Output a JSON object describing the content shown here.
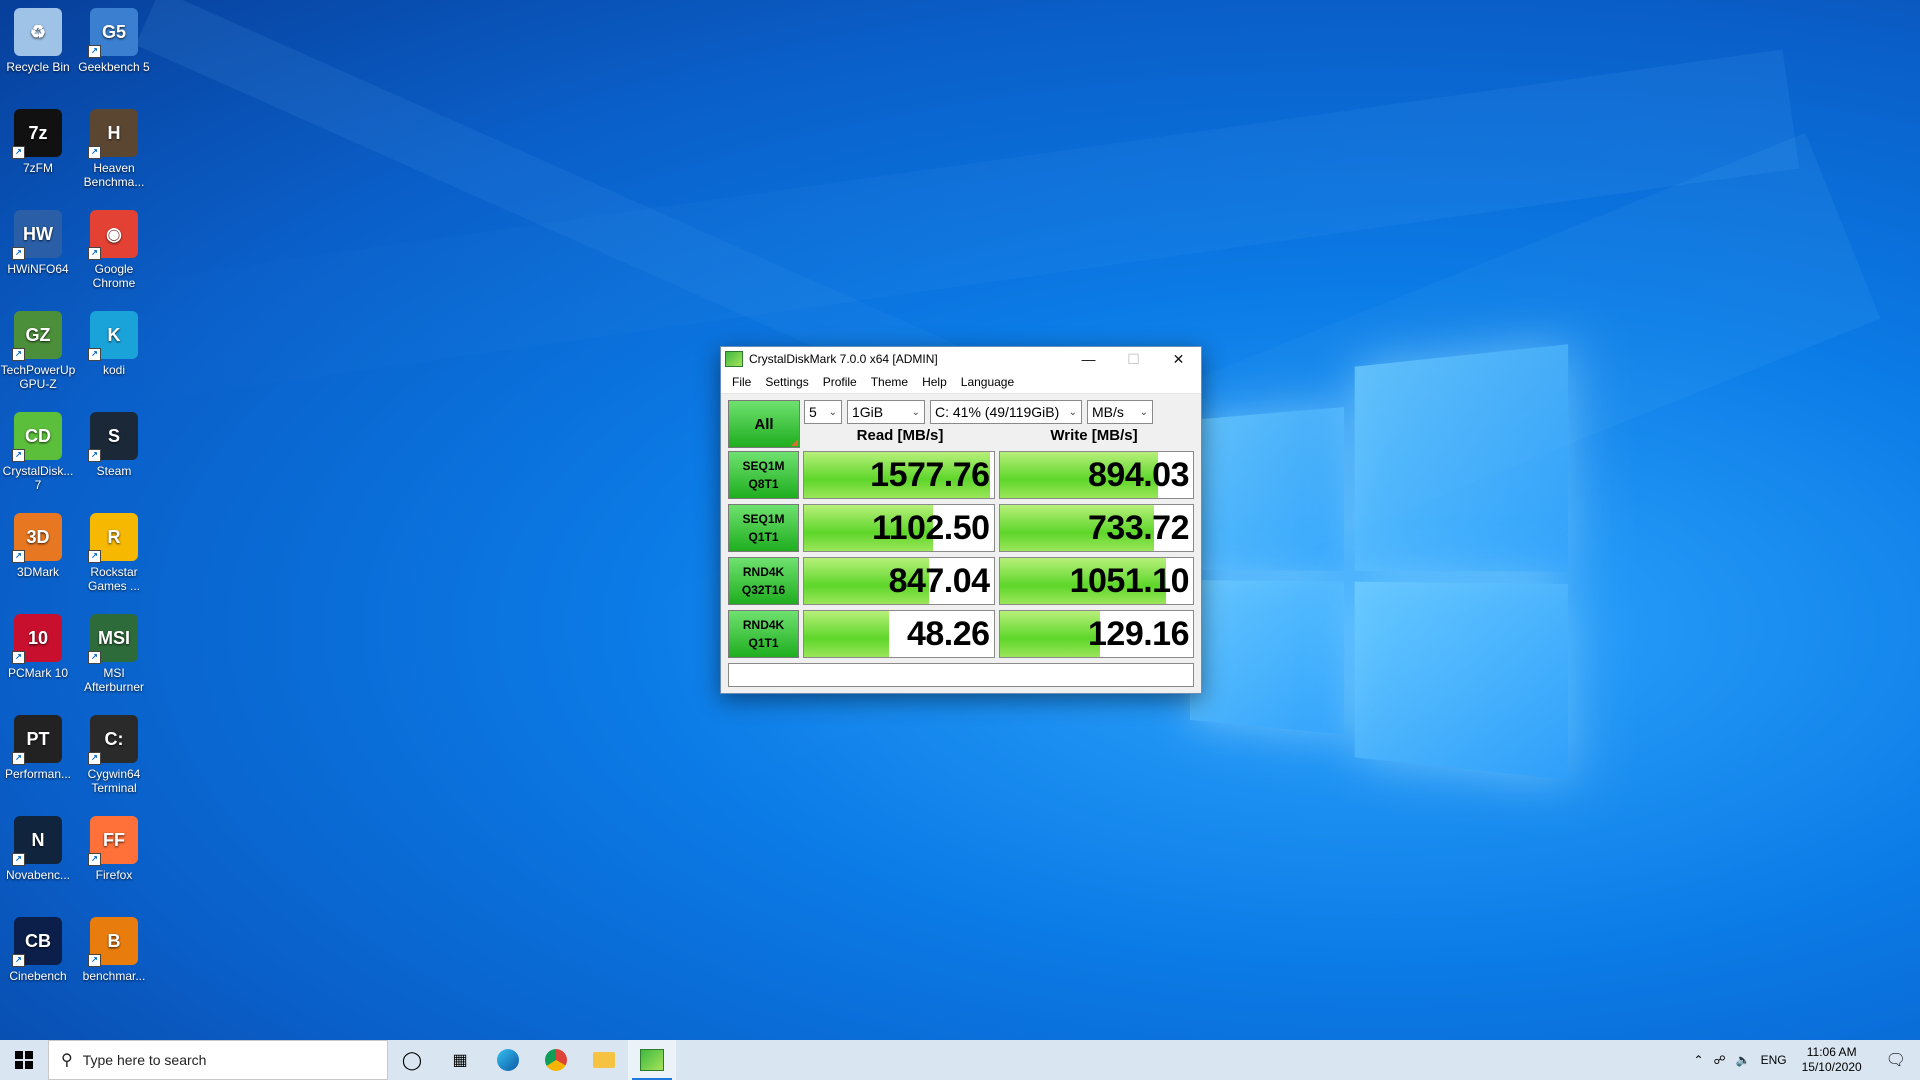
{
  "desktop_icons": [
    {
      "label": "Recycle Bin",
      "glyph": "♻",
      "color": "#9fc3e6"
    },
    {
      "label": "Geekbench 5",
      "glyph": "G5",
      "color": "#3a7fd0"
    },
    {
      "label": "7zFM",
      "glyph": "7z",
      "color": "#111111"
    },
    {
      "label": "Heaven Benchma...",
      "glyph": "H",
      "color": "#5b4632"
    },
    {
      "label": "HWiNFO64",
      "glyph": "HW",
      "color": "#2a5fa8"
    },
    {
      "label": "Google Chrome",
      "glyph": "◉",
      "color": "#e34133"
    },
    {
      "label": "TechPowerUp GPU-Z",
      "glyph": "GZ",
      "color": "#4c8f3a"
    },
    {
      "label": "kodi",
      "glyph": "K",
      "color": "#1aa3d9"
    },
    {
      "label": "CrystalDisk... 7",
      "glyph": "CD",
      "color": "#5cbf3b"
    },
    {
      "label": "Steam",
      "glyph": "S",
      "color": "#1b2838"
    },
    {
      "label": "3DMark",
      "glyph": "3D",
      "color": "#e87722"
    },
    {
      "label": "Rockstar Games ...",
      "glyph": "R",
      "color": "#f6b800"
    },
    {
      "label": "PCMark 10",
      "glyph": "10",
      "color": "#c8102e"
    },
    {
      "label": "MSI Afterburner",
      "glyph": "MSI",
      "color": "#2e6b3a"
    },
    {
      "label": "Performan...",
      "glyph": "PT",
      "color": "#222222"
    },
    {
      "label": "Cygwin64 Terminal",
      "glyph": "C:",
      "color": "#2a2a2a"
    },
    {
      "label": "Novabenc...",
      "glyph": "N",
      "color": "#10253d"
    },
    {
      "label": "Firefox",
      "glyph": "FF",
      "color": "#ff7139"
    },
    {
      "label": "Cinebench",
      "glyph": "CB",
      "color": "#0b1f4a"
    },
    {
      "label": "benchmar...",
      "glyph": "B",
      "color": "#e87d0d"
    }
  ],
  "window": {
    "title": "CrystalDiskMark 7.0.0 x64 [ADMIN]",
    "menu": [
      "File",
      "Settings",
      "Profile",
      "Theme",
      "Help",
      "Language"
    ],
    "all_button": "All",
    "count": "5",
    "size": "1GiB",
    "drive": "C: 41% (49/119GiB)",
    "unit": "MB/s",
    "read_header": "Read [MB/s]",
    "write_header": "Write [MB/s]",
    "tests": [
      {
        "line1": "SEQ1M",
        "line2": "Q8T1",
        "read": "1577.76",
        "write": "894.03",
        "read_fill": 0.98,
        "write_fill": 0.82
      },
      {
        "line1": "SEQ1M",
        "line2": "Q1T1",
        "read": "1102.50",
        "write": "733.72",
        "read_fill": 0.68,
        "write_fill": 0.8
      },
      {
        "line1": "RND4K",
        "line2": "Q32T16",
        "read": "847.04",
        "write": "1051.10",
        "read_fill": 0.66,
        "write_fill": 0.86
      },
      {
        "line1": "RND4K",
        "line2": "Q1T1",
        "read": "48.26",
        "write": "129.16",
        "read_fill": 0.45,
        "write_fill": 0.52
      }
    ],
    "comment": ""
  },
  "taskbar": {
    "search_placeholder": "Type here to search",
    "lang": "ENG",
    "time": "11:06 AM",
    "date": "15/10/2020"
  },
  "colors": {
    "accent": "#1f7ae0",
    "bar_green": "#5ed62a"
  }
}
